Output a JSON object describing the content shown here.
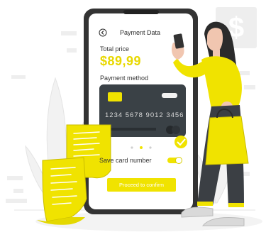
{
  "screen": {
    "title": "Payment Data",
    "total_label": "Total price",
    "total_value": "$89,99",
    "payment_method_label": "Payment method",
    "card_number": "1234 5678 9012 3456",
    "save_card_label": "Save card number",
    "save_card_enabled": true,
    "proceed_label": "Proceed to confirm",
    "carousel_active_index": 1
  },
  "icons": [
    "back-arrow-icon",
    "dollar-icon",
    "check-icon"
  ],
  "colors": {
    "accent": "#f0e300",
    "card": "#3a4146",
    "outline": "#2b2b2b",
    "background": "#ffffff"
  }
}
